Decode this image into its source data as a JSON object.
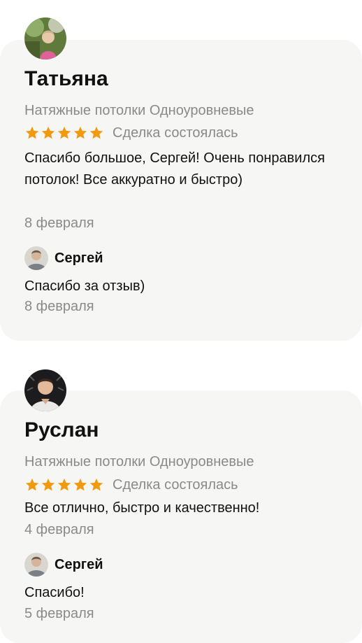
{
  "reviews": [
    {
      "author": "Татьяна",
      "category": "Натяжные потолки Одноуровневые",
      "rating": 5,
      "deal_status": "Сделка состоялась",
      "text": "Спасибо большое, Сергей! Очень понравился потолок! Все аккуратно и быстро)",
      "date": "8 февраля",
      "reply": {
        "author": "Сергей",
        "text": "Спасибо за отзыв)",
        "date": "8 февраля"
      }
    },
    {
      "author": "Руслан",
      "category": "Натяжные потолки Одноуровневые",
      "rating": 5,
      "deal_status": "Сделка состоялась",
      "text": "Все отлично, быстро и качественно!",
      "date": "4 февраля",
      "reply": {
        "author": "Сергей",
        "text": "Спасибо!",
        "date": "5 февраля"
      }
    }
  ],
  "colors": {
    "card_background": "#f6f6f5",
    "star": "#f29a0f",
    "muted_text": "#8a8a8a",
    "primary_text": "#111111"
  }
}
